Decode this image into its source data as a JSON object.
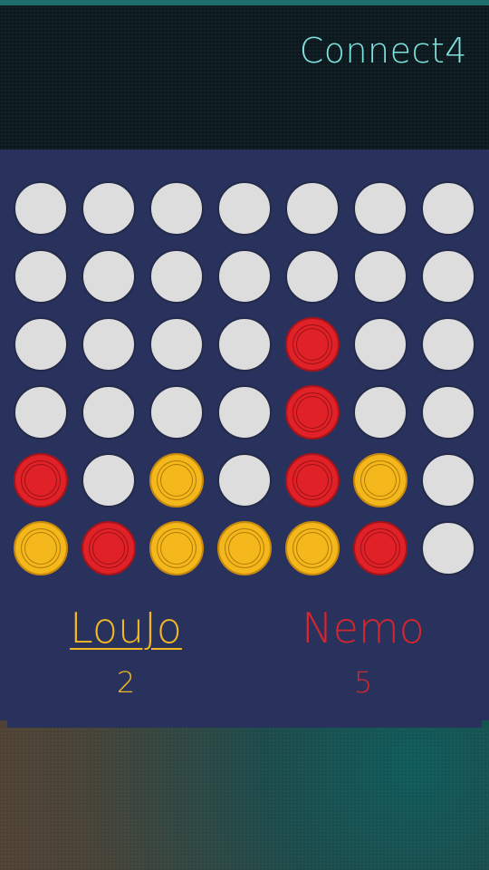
{
  "app": {
    "title": "Connect4"
  },
  "board": {
    "columns": 7,
    "rows": 6,
    "cells": [
      [
        "empty",
        "empty",
        "empty",
        "empty",
        "empty",
        "empty",
        "empty"
      ],
      [
        "empty",
        "empty",
        "empty",
        "empty",
        "empty",
        "empty",
        "empty"
      ],
      [
        "empty",
        "empty",
        "empty",
        "empty",
        "red",
        "empty",
        "empty"
      ],
      [
        "empty",
        "empty",
        "empty",
        "empty",
        "red",
        "empty",
        "empty"
      ],
      [
        "red",
        "empty",
        "yellow",
        "empty",
        "red",
        "yellow",
        "empty"
      ],
      [
        "yellow",
        "red",
        "yellow",
        "yellow",
        "yellow",
        "red",
        "empty"
      ]
    ]
  },
  "players": [
    {
      "name": "LouJo",
      "score": "2",
      "color": "#f2b824",
      "active": true
    },
    {
      "name": "Nemo",
      "score": "5",
      "color": "#d42630",
      "active": false
    }
  ],
  "colors": {
    "board_background": "#29325c",
    "empty_slot": "#dddddd",
    "red_disc": "#e02228",
    "yellow_disc": "#f5b81c",
    "title": "#7fe3df"
  }
}
